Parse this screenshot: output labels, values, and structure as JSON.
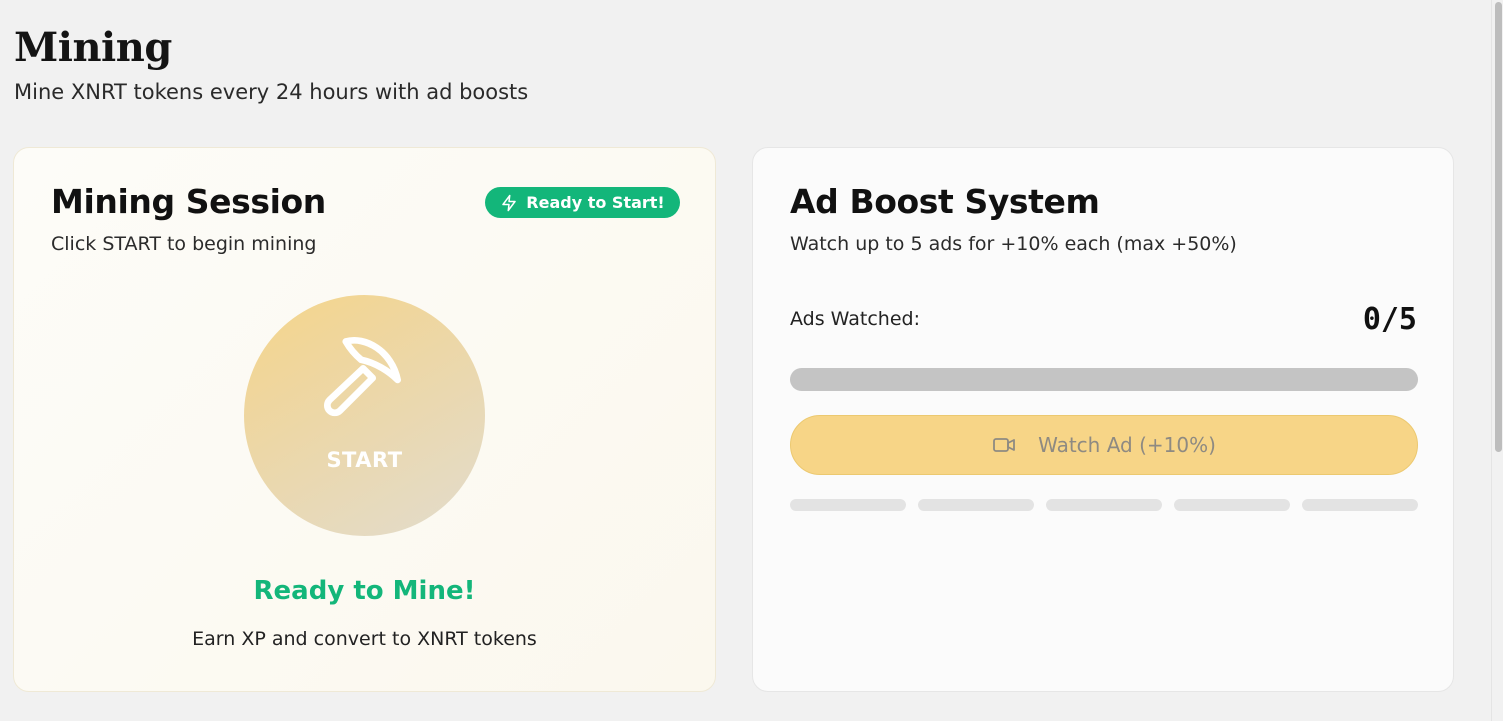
{
  "header": {
    "title": "Mining",
    "subtitle": "Mine XNRT tokens every 24 hours with ad boosts"
  },
  "mining_card": {
    "title": "Mining Session",
    "subtitle": "Click START to begin mining",
    "badge_label": "Ready to Start!",
    "badge_icon": "lightning-icon",
    "start_label": "START",
    "start_icon": "pickaxe-icon",
    "status_text": "Ready to Mine!",
    "info_text": "Earn XP and convert to XNRT tokens"
  },
  "ad_card": {
    "title": "Ad Boost System",
    "subtitle": "Watch up to 5 ads for +10% each (max +50%)",
    "ads_watched_label": "Ads Watched:",
    "ads_watched_count": "0/5",
    "progress_fraction": 0,
    "watch_button_label": "Watch Ad (+10%)",
    "watch_button_icon": "video-camera-icon",
    "segments_filled": 0,
    "segments_total": 5
  },
  "colors": {
    "accent_green": "#13b67a",
    "button_yellow": "#f7d587",
    "circle_gold": "#f5d58a",
    "progress_track": "#c4c4c4"
  }
}
